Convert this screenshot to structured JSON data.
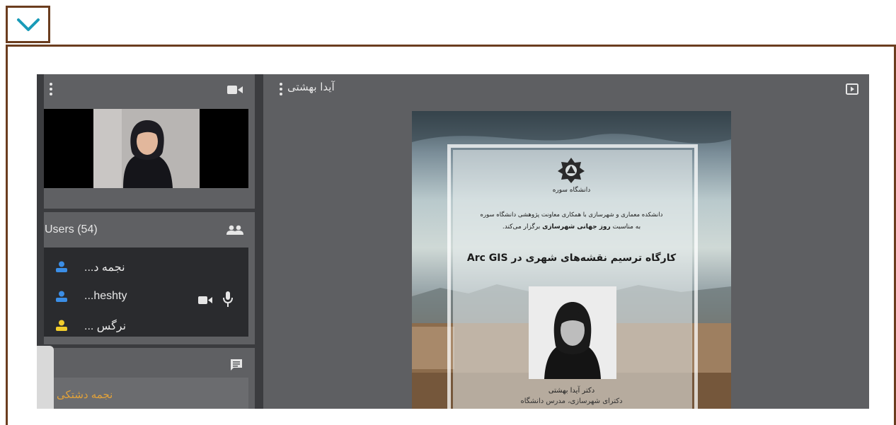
{
  "cam_panel": {},
  "users_panel": {
    "title": "Users (54)",
    "users": [
      {
        "name": "نجمه د...",
        "icon_color": "#3b8ee6"
      },
      {
        "name": "...heshty",
        "icon_color": "#3b8ee6"
      },
      {
        "name": "نرگس ...",
        "icon_color": "#f2cd2c"
      }
    ]
  },
  "chat_panel": {
    "preview_name": "نجمه دشتکی"
  },
  "presentation": {
    "presenter_name": "آیدا بهشتی",
    "poster": {
      "university": "دانشگاه سوره",
      "line1": "دانشکده معماری و شهرسازی با همکاری معاونت پژوهشی دانشگاه سوره",
      "line2_prefix": "به مناسبت",
      "line2_bold": "روز جهانی شهرسازی",
      "line2_suffix": "برگزار می‌کند.",
      "headline": "کارگاه ترسیم نقشه‌های شهری در Arc GIS",
      "caption": "دکتر آیدا بهشتی",
      "caption2": "دکترای شهرسازی، مدرس دانشگاه"
    }
  },
  "colors": {
    "frame_border": "#6b3d1f",
    "chevron": "#1a9bb8"
  }
}
